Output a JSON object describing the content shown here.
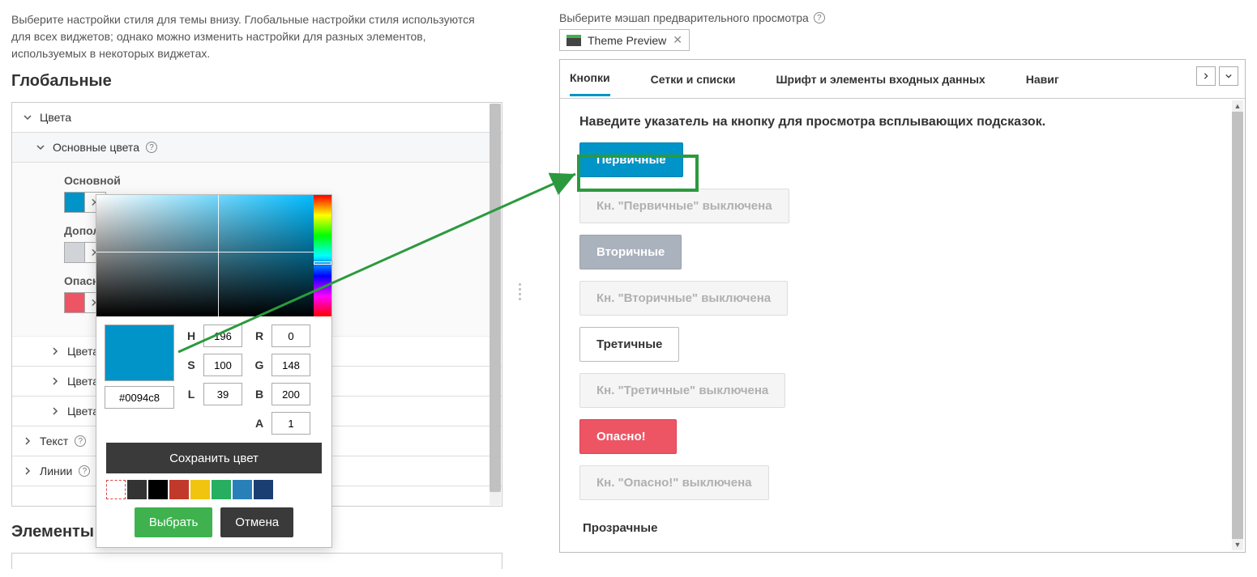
{
  "left": {
    "intro": "Выберите настройки стиля для темы внизу. Глобальные настройки стиля используются для всех виджетов; однако можно изменить настройки для разных элементов, используемых в некоторых виджетах.",
    "heading_global": "Глобальные",
    "heading_elements": "Элементы",
    "acc": {
      "colors": "Цвета",
      "base_colors": "Основные цвета",
      "primary": "Основной",
      "secondary": "Дополнительный",
      "danger": "Опасно!",
      "text_colors": "Цвета те",
      "bg_colors": "Цвета ф",
      "line_colors": "Цвета ли",
      "text": "Текст",
      "lines": "Линии"
    }
  },
  "picker": {
    "hex": "#0094c8",
    "h": "196",
    "s": "100",
    "l": "39",
    "r": "0",
    "g": "148",
    "b": "200",
    "a": "1",
    "labels": {
      "H": "H",
      "S": "S",
      "L": "L",
      "R": "R",
      "G": "G",
      "B": "B",
      "A": "A"
    },
    "save": "Сохранить цвет",
    "select": "Выбрать",
    "cancel": "Отмена",
    "swatches": [
      "#ffffff00",
      "#333333",
      "#000000",
      "#c0392b",
      "#f1c40f",
      "#27ae60",
      "#2980b9",
      "#1a3e72"
    ]
  },
  "right": {
    "mashup_label": "Выберите мэшап предварительного просмотра",
    "chip": "Theme Preview",
    "tabs": {
      "buttons": "Кнопки",
      "grids": "Сетки и списки",
      "fonts": "Шрифт и элементы входных данных",
      "nav": "Навиг"
    },
    "hint": "Наведите указатель на кнопку для просмотра всплывающих подсказок.",
    "btns": {
      "primary": "Первичные",
      "primary_off": "Кн. \"Первичные\" выключена",
      "secondary": "Вторичные",
      "secondary_off": "Кн. \"Вторичные\" выключена",
      "tertiary": "Третичные",
      "tertiary_off": "Кн. \"Третичные\" выключена",
      "danger": "Опасно!",
      "danger_off": "Кн. \"Опасно!\" выключена",
      "transparent": "Прозрачные"
    }
  }
}
